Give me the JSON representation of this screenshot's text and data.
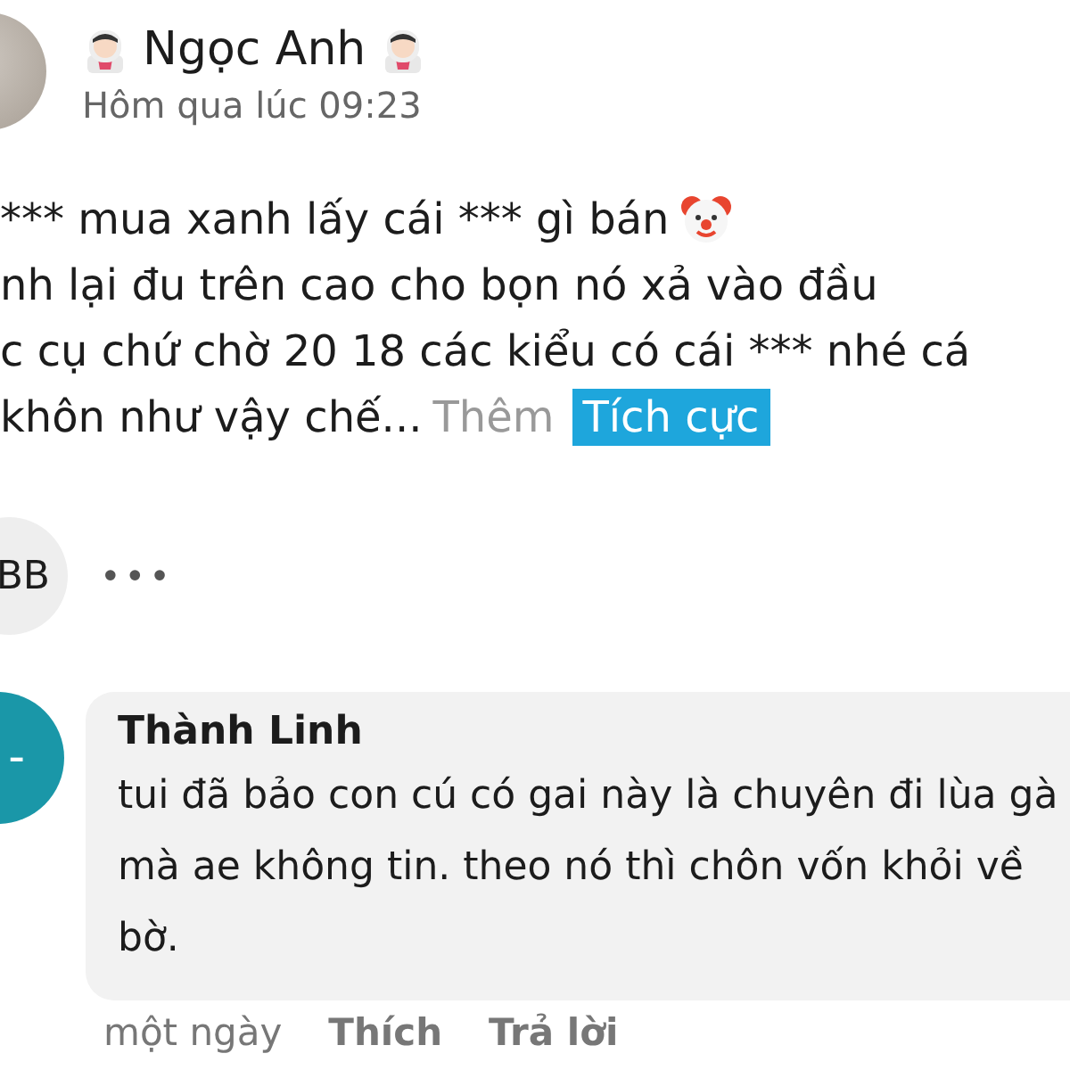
{
  "post": {
    "author": "Ngọc Anh",
    "time": "Hôm qua lúc 09:23",
    "lines": [
      "*** mua xanh lấy cái *** gì bán",
      "nh lại đu trên cao cho bọn nó xả vào đầu",
      "c cụ chứ chờ 20 18 các kiểu có cái *** nhé cá",
      "khôn như vậy chế..."
    ],
    "more": "Thêm",
    "tag": "Tích cực"
  },
  "reactor": {
    "initials": "BB",
    "more": "•••"
  },
  "comment": {
    "author": "Thành Linh",
    "avatar": "-",
    "text": "tui đã bảo con cú có gai này là chuyên đi lùa gà mà ae không tin. theo nó thì chôn vốn khỏi về  bờ.",
    "time": "một ngày",
    "actions": [
      "Thích",
      "Trả lời"
    ]
  }
}
